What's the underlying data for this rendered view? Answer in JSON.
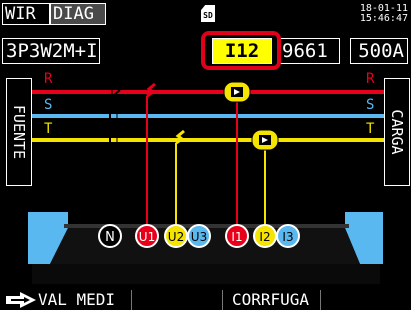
{
  "tabs": {
    "wir": "WIR",
    "diag": "DIAG"
  },
  "sd_label": "SD",
  "clock": {
    "date": "18-01-11",
    "time": "15:46:47"
  },
  "wiring": "3P3W2M+I",
  "channel": "I12",
  "value": "9661",
  "range": "500A",
  "labels": {
    "source": "FUENTE",
    "load": "CARGA"
  },
  "phases_left": [
    "R",
    "S",
    "T"
  ],
  "phases_right": [
    "R",
    "S",
    "T"
  ],
  "terminals": [
    "N",
    "U1",
    "U2",
    "U3",
    "I1",
    "I2",
    "I3"
  ],
  "softkeys": {
    "k1": "VAL MEDI",
    "k2": "",
    "k3": "CORRFUGA",
    "k4": ""
  },
  "colors": {
    "r": "#e8001a",
    "s": "#5ab8f0",
    "t": "#f5e400",
    "highlight": "#e0001a",
    "channel_bg": "#ffff00",
    "clamp": "#5ab8f0"
  }
}
